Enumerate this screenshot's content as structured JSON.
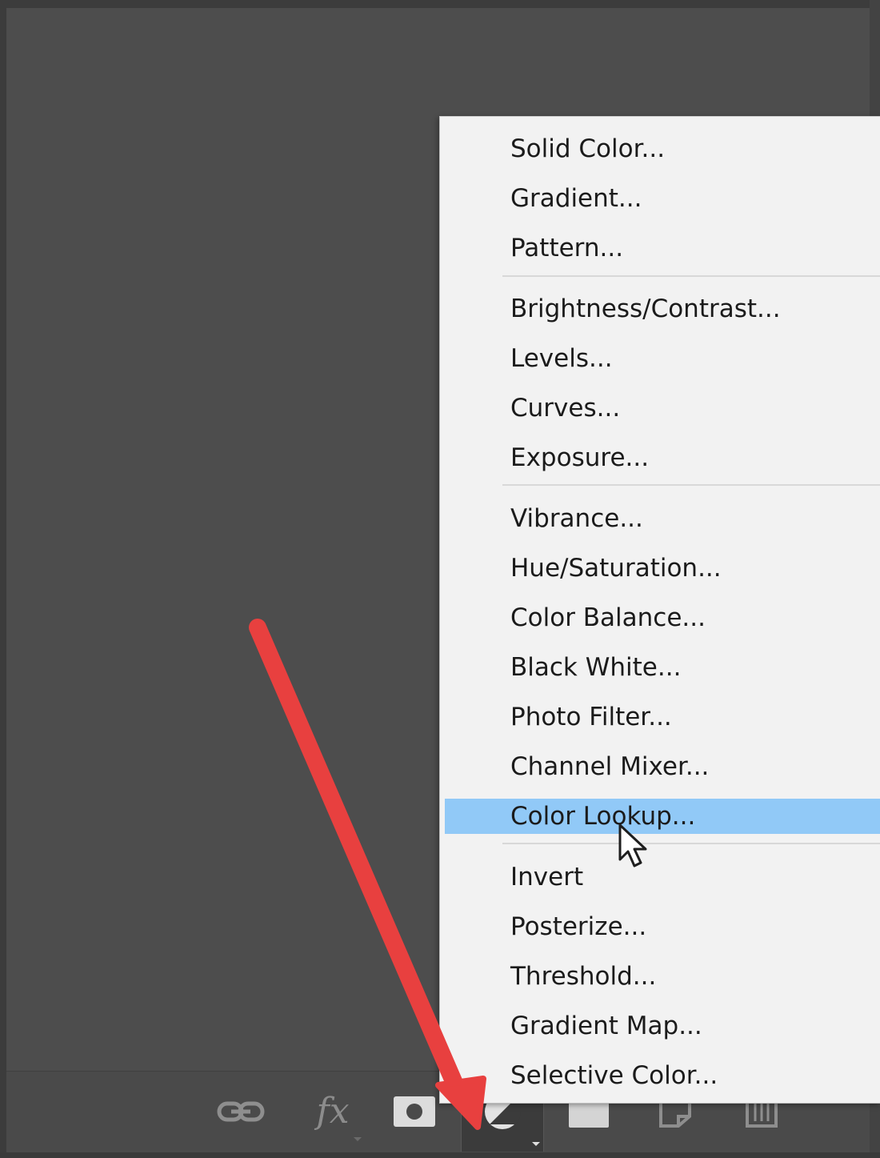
{
  "app": {
    "workspace_bg": "#4d4d4d",
    "toolbar_bg": "#4a4a4a",
    "icon_color": "#8e8e8e"
  },
  "toolbar": {
    "items": [
      {
        "icon": "link-icon"
      },
      {
        "icon": "fx-icon",
        "glyph": "fx"
      },
      {
        "icon": "mask-icon"
      },
      {
        "icon": "adjustment-layer-icon",
        "active": true
      },
      {
        "icon": "group-folder-icon"
      },
      {
        "icon": "new-layer-icon"
      },
      {
        "icon": "trash-icon"
      }
    ]
  },
  "adjustment_menu": {
    "bg": "#f2f2f2",
    "highlight_color": "#91c9f7",
    "highlighted_item": "Color Lookup...",
    "groups": [
      [
        "Solid Color...",
        "Gradient...",
        "Pattern..."
      ],
      [
        "Brightness/Contrast...",
        "Levels...",
        "Curves...",
        "Exposure..."
      ],
      [
        "Vibrance...",
        "Hue/Saturation...",
        "Color Balance...",
        "Black  White...",
        "Photo Filter...",
        "Channel Mixer...",
        "Color Lookup..."
      ],
      [
        "Invert",
        "Posterize...",
        "Threshold...",
        "Gradient Map...",
        "Selective Color..."
      ]
    ]
  },
  "annotation": {
    "arrow_color": "#e8403f",
    "pointer": "cursor-arrow"
  }
}
